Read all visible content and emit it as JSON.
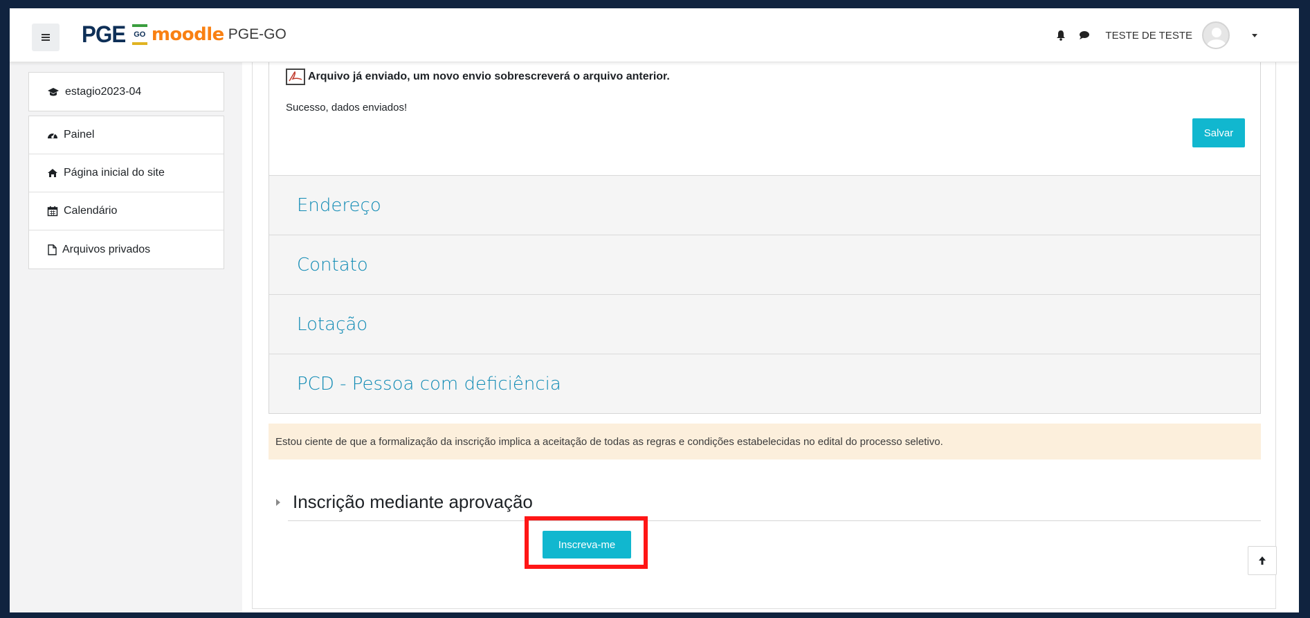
{
  "navbar": {
    "logo_pge": "PGE",
    "logo_go": "GO",
    "logo_moodle": "moodle",
    "site_name": "PGE-GO",
    "user_name": "TESTE DE TESTE",
    "icons": [
      "menu-icon",
      "bell-icon",
      "chat-icon",
      "avatar",
      "caret-down-icon"
    ]
  },
  "sidebar": {
    "course": {
      "label": "estagio2023-04",
      "icon": "graduation-cap-icon"
    },
    "items": [
      {
        "label": "Painel",
        "icon": "dashboard-icon"
      },
      {
        "label": "Página inicial do site",
        "icon": "home-icon"
      },
      {
        "label": "Calendário",
        "icon": "calendar-icon"
      },
      {
        "label": "Arquivos privados",
        "icon": "file-icon"
      }
    ]
  },
  "form": {
    "file_notice": "Arquivo já enviado, um novo envio sobrescreverá o arquivo anterior.",
    "success_message": "Sucesso, dados enviados!",
    "save_label": "Salvar",
    "sections": [
      "Endereço",
      "Contato",
      "Lotação",
      "PCD - Pessoa com deficiência"
    ]
  },
  "notice": "Estou ciente de que a formalização da inscrição implica a aceitação de todas as regras e condições estabelecidas no edital do processo seletivo.",
  "enrolment": {
    "title": "Inscrição mediante aprovação",
    "button_label": "Inscreva-me"
  },
  "colors": {
    "frame_border": "#10233f",
    "accent": "#11b7cf",
    "section_link": "#0f8ab4",
    "highlight": "#ff1616",
    "notice_bg": "#fcefdc",
    "moodle_orange": "#f98012"
  }
}
